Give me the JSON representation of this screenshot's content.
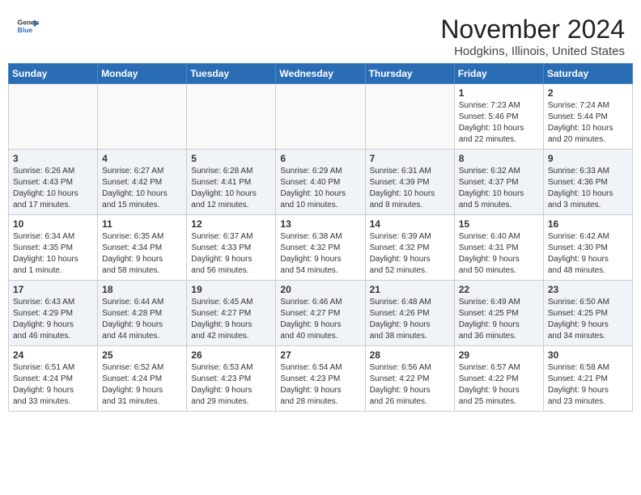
{
  "header": {
    "logo_line1": "General",
    "logo_line2": "Blue",
    "title": "November 2024",
    "subtitle": "Hodgkins, Illinois, United States"
  },
  "weekdays": [
    "Sunday",
    "Monday",
    "Tuesday",
    "Wednesday",
    "Thursday",
    "Friday",
    "Saturday"
  ],
  "weeks": [
    [
      {
        "day": "",
        "info": ""
      },
      {
        "day": "",
        "info": ""
      },
      {
        "day": "",
        "info": ""
      },
      {
        "day": "",
        "info": ""
      },
      {
        "day": "",
        "info": ""
      },
      {
        "day": "1",
        "info": "Sunrise: 7:23 AM\nSunset: 5:46 PM\nDaylight: 10 hours\nand 22 minutes."
      },
      {
        "day": "2",
        "info": "Sunrise: 7:24 AM\nSunset: 5:44 PM\nDaylight: 10 hours\nand 20 minutes."
      }
    ],
    [
      {
        "day": "3",
        "info": "Sunrise: 6:26 AM\nSunset: 4:43 PM\nDaylight: 10 hours\nand 17 minutes."
      },
      {
        "day": "4",
        "info": "Sunrise: 6:27 AM\nSunset: 4:42 PM\nDaylight: 10 hours\nand 15 minutes."
      },
      {
        "day": "5",
        "info": "Sunrise: 6:28 AM\nSunset: 4:41 PM\nDaylight: 10 hours\nand 12 minutes."
      },
      {
        "day": "6",
        "info": "Sunrise: 6:29 AM\nSunset: 4:40 PM\nDaylight: 10 hours\nand 10 minutes."
      },
      {
        "day": "7",
        "info": "Sunrise: 6:31 AM\nSunset: 4:39 PM\nDaylight: 10 hours\nand 8 minutes."
      },
      {
        "day": "8",
        "info": "Sunrise: 6:32 AM\nSunset: 4:37 PM\nDaylight: 10 hours\nand 5 minutes."
      },
      {
        "day": "9",
        "info": "Sunrise: 6:33 AM\nSunset: 4:36 PM\nDaylight: 10 hours\nand 3 minutes."
      }
    ],
    [
      {
        "day": "10",
        "info": "Sunrise: 6:34 AM\nSunset: 4:35 PM\nDaylight: 10 hours\nand 1 minute."
      },
      {
        "day": "11",
        "info": "Sunrise: 6:35 AM\nSunset: 4:34 PM\nDaylight: 9 hours\nand 58 minutes."
      },
      {
        "day": "12",
        "info": "Sunrise: 6:37 AM\nSunset: 4:33 PM\nDaylight: 9 hours\nand 56 minutes."
      },
      {
        "day": "13",
        "info": "Sunrise: 6:38 AM\nSunset: 4:32 PM\nDaylight: 9 hours\nand 54 minutes."
      },
      {
        "day": "14",
        "info": "Sunrise: 6:39 AM\nSunset: 4:32 PM\nDaylight: 9 hours\nand 52 minutes."
      },
      {
        "day": "15",
        "info": "Sunrise: 6:40 AM\nSunset: 4:31 PM\nDaylight: 9 hours\nand 50 minutes."
      },
      {
        "day": "16",
        "info": "Sunrise: 6:42 AM\nSunset: 4:30 PM\nDaylight: 9 hours\nand 48 minutes."
      }
    ],
    [
      {
        "day": "17",
        "info": "Sunrise: 6:43 AM\nSunset: 4:29 PM\nDaylight: 9 hours\nand 46 minutes."
      },
      {
        "day": "18",
        "info": "Sunrise: 6:44 AM\nSunset: 4:28 PM\nDaylight: 9 hours\nand 44 minutes."
      },
      {
        "day": "19",
        "info": "Sunrise: 6:45 AM\nSunset: 4:27 PM\nDaylight: 9 hours\nand 42 minutes."
      },
      {
        "day": "20",
        "info": "Sunrise: 6:46 AM\nSunset: 4:27 PM\nDaylight: 9 hours\nand 40 minutes."
      },
      {
        "day": "21",
        "info": "Sunrise: 6:48 AM\nSunset: 4:26 PM\nDaylight: 9 hours\nand 38 minutes."
      },
      {
        "day": "22",
        "info": "Sunrise: 6:49 AM\nSunset: 4:25 PM\nDaylight: 9 hours\nand 36 minutes."
      },
      {
        "day": "23",
        "info": "Sunrise: 6:50 AM\nSunset: 4:25 PM\nDaylight: 9 hours\nand 34 minutes."
      }
    ],
    [
      {
        "day": "24",
        "info": "Sunrise: 6:51 AM\nSunset: 4:24 PM\nDaylight: 9 hours\nand 33 minutes."
      },
      {
        "day": "25",
        "info": "Sunrise: 6:52 AM\nSunset: 4:24 PM\nDaylight: 9 hours\nand 31 minutes."
      },
      {
        "day": "26",
        "info": "Sunrise: 6:53 AM\nSunset: 4:23 PM\nDaylight: 9 hours\nand 29 minutes."
      },
      {
        "day": "27",
        "info": "Sunrise: 6:54 AM\nSunset: 4:23 PM\nDaylight: 9 hours\nand 28 minutes."
      },
      {
        "day": "28",
        "info": "Sunrise: 6:56 AM\nSunset: 4:22 PM\nDaylight: 9 hours\nand 26 minutes."
      },
      {
        "day": "29",
        "info": "Sunrise: 6:57 AM\nSunset: 4:22 PM\nDaylight: 9 hours\nand 25 minutes."
      },
      {
        "day": "30",
        "info": "Sunrise: 6:58 AM\nSunset: 4:21 PM\nDaylight: 9 hours\nand 23 minutes."
      }
    ]
  ]
}
